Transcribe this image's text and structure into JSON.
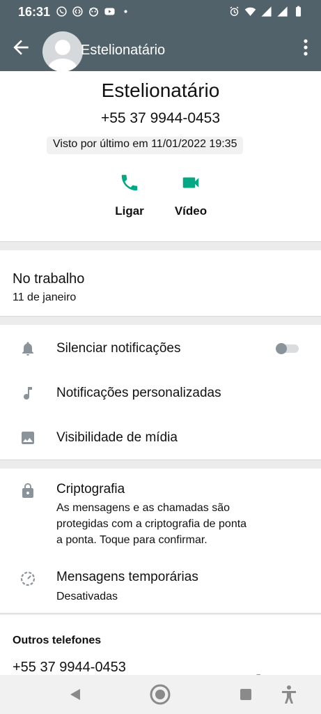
{
  "status_bar": {
    "time": "16:31",
    "icons_left": [
      "whatsapp-icon",
      "shazam-icon",
      "vpn-icon",
      "youtube-icon",
      "dot-icon"
    ],
    "icons_right": [
      "alarm-icon",
      "wifi-icon",
      "signal-icon",
      "signal-icon",
      "battery-icon"
    ]
  },
  "app_bar": {
    "title": "Estelionatário",
    "back_icon": "arrow-back-icon",
    "menu_icon": "more-vert-icon"
  },
  "contact": {
    "name": "Estelionatário",
    "phone": "+55 37 9944-0453",
    "last_seen": "Visto por último em 11/01/2022 19:35",
    "actions": [
      {
        "label": "Ligar",
        "icon": "phone-icon"
      },
      {
        "label": "Vídeo",
        "icon": "videocam-icon"
      }
    ]
  },
  "about": {
    "text": "No trabalho",
    "date": "11 de janeiro"
  },
  "settings": {
    "mute_label": "Silenciar notificações",
    "mute_enabled": false,
    "custom_notifications_label": "Notificações personalizadas",
    "media_visibility_label": "Visibilidade de mídia"
  },
  "encryption": {
    "title": "Criptografia",
    "description_lines": [
      "As mensagens e as chamadas são",
      "protegidas com a criptografia de ponta",
      "a ponta. Toque para confirmar."
    ]
  },
  "disappearing": {
    "title": "Mensagens temporárias",
    "status": "Desativadas"
  },
  "other_phones": {
    "title": "Outros telefones",
    "phone": "+55 37 9944-0453"
  },
  "colors": {
    "header": "#51626b",
    "accent": "#00a884",
    "icon_gray": "#8a9399"
  }
}
